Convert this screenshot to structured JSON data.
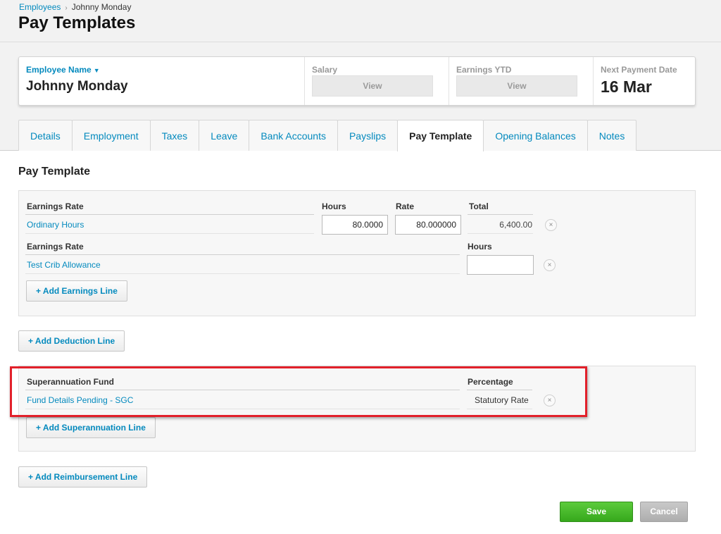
{
  "breadcrumb": {
    "parent": "Employees",
    "separator": "›",
    "current": "Johnny Monday"
  },
  "page_title": "Pay Templates",
  "summary": {
    "employee_label": "Employee Name",
    "employee_caret": "▼",
    "employee_name": "Johnny Monday",
    "salary_label": "Salary",
    "salary_button": "View",
    "earnings_ytd_label": "Earnings YTD",
    "earnings_ytd_button": "View",
    "next_payment_label": "Next Payment Date",
    "next_payment_value": "16 Mar"
  },
  "tabs": [
    {
      "label": "Details",
      "active": false
    },
    {
      "label": "Employment",
      "active": false
    },
    {
      "label": "Taxes",
      "active": false
    },
    {
      "label": "Leave",
      "active": false
    },
    {
      "label": "Bank Accounts",
      "active": false
    },
    {
      "label": "Payslips",
      "active": false
    },
    {
      "label": "Pay Template",
      "active": true
    },
    {
      "label": "Opening Balances",
      "active": false
    },
    {
      "label": "Notes",
      "active": false
    }
  ],
  "section_title": "Pay Template",
  "earnings": {
    "line1": {
      "col_rate": "Earnings Rate",
      "col_hours": "Hours",
      "col_rate_value": "Rate",
      "col_total": "Total",
      "name": "Ordinary Hours",
      "hours": "80.0000",
      "rate": "80.000000",
      "total": "6,400.00"
    },
    "line2": {
      "col_rate": "Earnings Rate",
      "col_hours": "Hours",
      "name": "Test Crib Allowance",
      "hours": ""
    },
    "add_button": "+ Add Earnings Line"
  },
  "deduction": {
    "add_button": "+ Add Deduction Line"
  },
  "superannuation": {
    "col_fund": "Superannuation Fund",
    "col_percentage": "Percentage",
    "fund_name": "Fund Details Pending - SGC",
    "percentage": "Statutory Rate",
    "add_button": "+ Add Superannuation Line"
  },
  "reimbursement": {
    "add_button": "+ Add Reimbursement Line"
  },
  "footer": {
    "save": "Save",
    "cancel": "Cancel"
  },
  "remove_glyph": "×",
  "colors": {
    "link": "#048abe",
    "save": "#36a81c",
    "highlight": "#e2202a"
  }
}
